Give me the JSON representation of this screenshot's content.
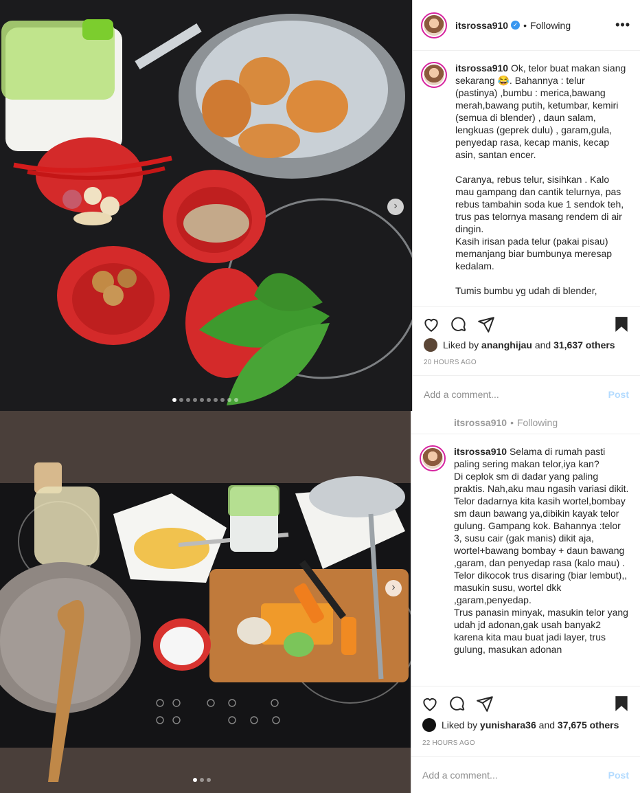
{
  "post1": {
    "username": "itsrossa910",
    "follow_label": "Following",
    "more_label": "•••",
    "caption_user": "itsrossa910",
    "caption_text": "Ok, telor buat makan siang sekarang 😂. Bahannya : telur (pastinya) ,bumbu : merica,bawang merah,bawang putih, ketumbar, kemiri (semua di blender) , daun salam, lengkuas (geprek dulu) , garam,gula, penyedap rasa, kecap manis, kecap asin, santan encer.\n\nCaranya, rebus telur, sisihkan . Kalo mau gampang dan cantik telurnya, pas rebus tambahin soda kue 1 sendok teh, trus pas telornya masang rendem di air dingin.\nKasih irisan pada telur (pakai pisau) memanjang biar bumbunya meresap kedalam.\n\nTumis bumbu yg udah di blender,",
    "liked_by_prefix": "Liked by",
    "liked_by_user": "ananghijau",
    "liked_by_and": "and",
    "likes_count": "31,637 others",
    "time_ago": "20 HOURS AGO",
    "comment_placeholder": "Add a comment...",
    "post_label": "Post",
    "carousel_total": 10,
    "carousel_active": 0
  },
  "post2": {
    "username": "itsrossa910",
    "follow_label": "Following",
    "caption_user": "itsrossa910",
    "caption_text": "Selama di rumah pasti paling sering makan telor,iya kan?\nDi ceplok sm di dadar yang paling praktis. Nah,aku mau ngasih variasi dikit. Telor dadarnya kita kasih wortel,bombay sm daun bawang ya,dibikin kayak telor gulung. Gampang kok. Bahannya :telor 3, susu cair (gak manis) dikit aja, wortel+bawang bombay + daun bawang ,garam, dan penyedap rasa (kalo mau) .\nTelor dikocok trus disaring (biar lembut),, masukin susu, wortel dkk ,garam,penyedap.\nTrus panasin minyak, masukin telor yang udah jd adonan,gak usah banyak2 karena kita mau buat jadi layer, trus gulung, masukan adonan",
    "liked_by_prefix": "Liked by",
    "liked_by_user": "yunishara36",
    "liked_by_and": "and",
    "likes_count": "37,675 others",
    "time_ago": "22 HOURS AGO",
    "comment_placeholder": "Add a comment...",
    "post_label": "Post",
    "carousel_total": 3,
    "carousel_active": 0
  },
  "icons": [
    "heart-icon",
    "comment-icon",
    "share-icon",
    "bookmark-icon",
    "verified-icon",
    "chevron-right-icon"
  ],
  "colors": {
    "accent": "#3897f0",
    "post_disabled": "#b3dbff",
    "muted": "#8e8e8e",
    "text": "#262626"
  }
}
